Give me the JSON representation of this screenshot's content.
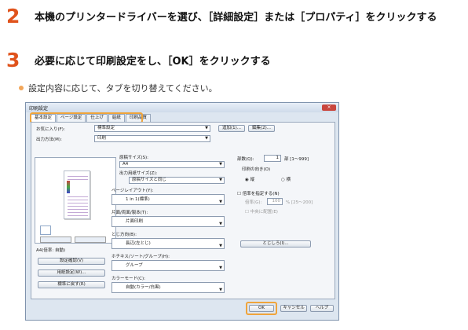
{
  "step2": {
    "number": "2",
    "text": "本機のプリンタードライバーを選び、［詳細設定］または［プロパティ］をクリックする"
  },
  "step3": {
    "number": "3",
    "text": "必要に応じて印刷設定をし、［OK］をクリックする"
  },
  "note": "設定内容に応じて、タブを切り替えてください。",
  "dialog": {
    "title": "印刷設定",
    "close": "×",
    "tabs": [
      "基本設定",
      "ページ設定",
      "仕上げ",
      "給紙",
      "印刷品質"
    ],
    "favorites_label": "お気に入り(F):",
    "favorites_value": "標準設定",
    "add_button": "追加(1)...",
    "edit_button": "編集(2)...",
    "output_label": "出力方法(M):",
    "output_value": "印刷",
    "paper_size_label": "原稿サイズ(S):",
    "paper_size_value": "A4",
    "output_paper_label": "出力用紙サイズ(Z):",
    "output_paper_value": "原稿サイズと同じ",
    "layout_label": "ページレイアウト(Y):",
    "layout_value": "1 in 1(標準)",
    "duplex_label": "片面/両面/製本(T):",
    "duplex_value": "片面印刷",
    "binding_label": "とじ方向(B):",
    "binding_value": "長辺(左とじ)",
    "staple_label": "ホチキス/ソート/グループ(H):",
    "staple_value": "グループ",
    "color_label": "カラーモード(C):",
    "color_value": "自動(カラー/白黒)",
    "copies_label": "部数(Q):",
    "copies_value": "1",
    "copies_range": "部 [1～999]",
    "orientation_label": "印刷の向き(O)",
    "portrait": "縦",
    "landscape": "横",
    "scale_label": "倍率を指定する(N)",
    "scale_field_label": "倍率(G):",
    "scale_value": "100",
    "scale_range": "% [25～200]",
    "center_label": "中央に配置(E)",
    "binding_btn": "とじしろ(I)...",
    "preview_caption": "A4(倍率: 自動)",
    "confirm_btn": "設定確認(V)",
    "paper_settings_btn": "用紙設定(W)...",
    "restore_btn": "標準に戻す(R)",
    "ok": "OK",
    "cancel": "キャンセル",
    "help": "ヘルプ"
  }
}
